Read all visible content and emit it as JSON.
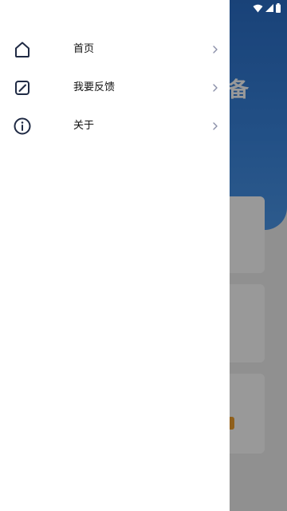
{
  "background": {
    "title_fragment": "备"
  },
  "drawer": {
    "items": [
      {
        "label": "首页",
        "icon": "home-icon"
      },
      {
        "label": "我要反馈",
        "icon": "edit-icon"
      },
      {
        "label": "关于",
        "icon": "info-icon"
      }
    ]
  },
  "colors": {
    "icon": "#1f2a44",
    "chevron": "#8a8fa8",
    "header_blue": "#2f78d6"
  }
}
